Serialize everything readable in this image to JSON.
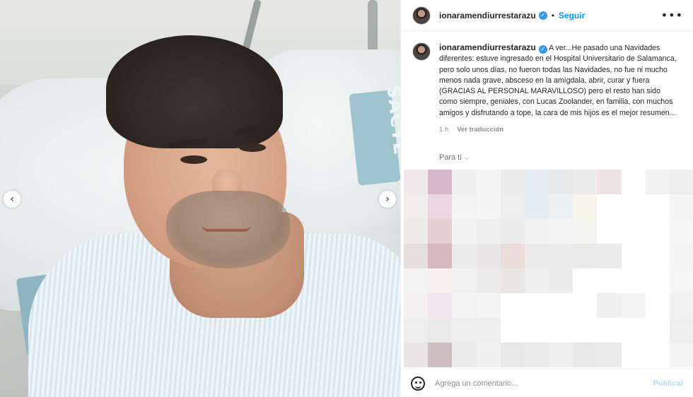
{
  "post": {
    "username": "ionaramendiurrestarazu",
    "follow_label": "Seguir",
    "more_label": "•••",
    "dot": "•",
    "verified_glyph": "✓",
    "caption_text": "A ver...He pasado una Navidades diferentes: estuve ingresado en el Hospital Universitario de Salamanca, pero solo unos días, no fueron todas las Navidades, no fue ni mucho menos nada grave, absceso en la amígdala, abrir, curar y fuera (GRACIAS AL PERSONAL MARAVILLOSO) pero el resto han sido como siempre, geniales, con Lucas Zoolander, en familia, con muchos amigos y disfrutando a tope, la cara de mis hijos es el mejor resumen...",
    "time": "1 h",
    "translate_label": "Ver traducción",
    "section_label": "Para ti",
    "chevron": "⌵"
  },
  "photo": {
    "prev_glyph": "‹",
    "next_glyph": "›",
    "pillow_text": "sacyl",
    "pillow_text_right": "SACYL"
  },
  "comment": {
    "placeholder": "Agrega un comentario...",
    "publish_label": "Publicar"
  },
  "pixel_colors": [
    [
      "#f1e9ec",
      "#d7b8c8",
      "#efefef",
      "#f4f4f4",
      "#ececec",
      "#e6eef4",
      "#e7e8e9",
      "#ececec",
      "#efe3e2",
      "#ffffff",
      "#f2f2f2",
      "#eeeeee"
    ],
    [
      "#f2ecec",
      "#ebd7e1",
      "#f3f3f3",
      "#f5f5f5",
      "#eeeeee",
      "#e5eef4",
      "#eef1f3",
      "#f6f5ec",
      "#ffffff",
      "#ffffff",
      "#ffffff",
      "#f5f5f5"
    ],
    [
      "#eeeaea",
      "#e6cfcf",
      "#f2f2f2",
      "#efefef",
      "#ececec",
      "#f1f1f1",
      "#f4f4f4",
      "#f4f4f1",
      "#ffffff",
      "#ffffff",
      "#ffffff",
      "#f7f7f7"
    ],
    [
      "#e7dede",
      "#d7b8bc",
      "#ebebeb",
      "#e8e6e6",
      "#eadcd8",
      "#ebebeb",
      "#ececec",
      "#eaeaea",
      "#ebebeb",
      "#ffffff",
      "#ffffff",
      "#f5f5f5"
    ],
    [
      "#f3f3f3",
      "#f6f0f0",
      "#f1f1f1",
      "#ebebeb",
      "#e9e6e6",
      "#efefef",
      "#ececec",
      "#ffffff",
      "#ffffff",
      "#ffffff",
      "#ffffff",
      "#f6f6f6"
    ],
    [
      "#f4f1f2",
      "#f2e5eb",
      "#f3f3f3",
      "#f4f4f4",
      "#ffffff",
      "#ffffff",
      "#ffffff",
      "#ffffff",
      "#f0f0f0",
      "#f4f4f4",
      "#ffffff",
      "#f1f1f1"
    ],
    [
      "#eeeeee",
      "#e9e9e9",
      "#eeeeee",
      "#eeeeee",
      "#ffffff",
      "#ffffff",
      "#ffffff",
      "#ffffff",
      "#ffffff",
      "#ffffff",
      "#ffffff",
      "#eeeeee"
    ],
    [
      "#e9e5e6",
      "#cdbec2",
      "#ececec",
      "#f0f0f0",
      "#e8e8e8",
      "#e9e9e9",
      "#eeeeee",
      "#e8e8e8",
      "#ebebeb",
      "#ffffff",
      "#ffffff",
      "#f4f4f4"
    ]
  ]
}
